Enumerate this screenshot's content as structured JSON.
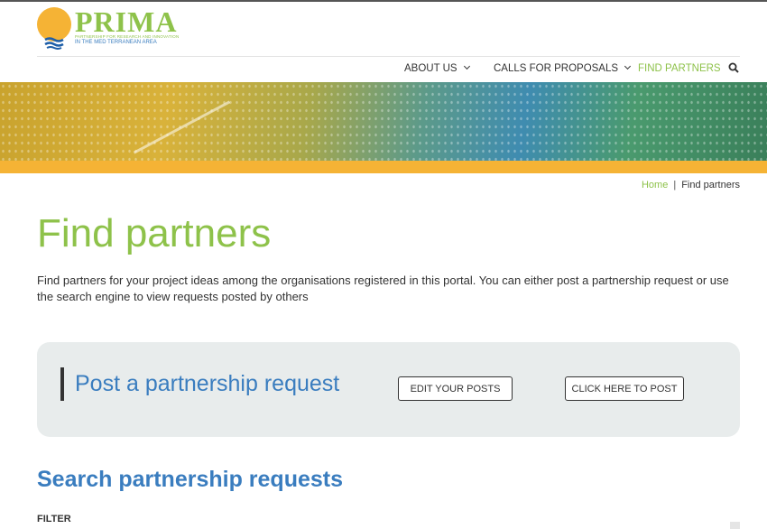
{
  "header": {
    "logo": {
      "word": "PRIMA",
      "subtitle_1": "PARTNERSHIP FOR RESEARCH AND INNOVATION",
      "subtitle_2": "IN THE MED TERRANEAN AREA"
    },
    "nav": {
      "about_us": "ABOUT US",
      "calls_for_proposals": "CALLS FOR PROPOSALS",
      "find_partners": "FIND PARTNERS"
    },
    "search_icon": "search-icon"
  },
  "colors": {
    "accent_green": "#8ec24a",
    "accent_blue": "#3a7dbf",
    "accent_yellow": "#f5b335",
    "panel_bg": "#e8ecec"
  },
  "breadcrumb": {
    "home": "Home",
    "separator": "|",
    "current": "Find partners"
  },
  "main": {
    "title": "Find partners",
    "intro": "Find partners for your project ideas among the organisations registered in this portal. You can either post a partnership request or use the search engine to view requests posted by others",
    "post_panel": {
      "title": "Post a partnership request",
      "edit_button": "EDIT YOUR POSTS",
      "post_button": "CLICK HERE TO POST"
    },
    "search": {
      "title": "Search partnership requests",
      "filter_label": "FILTER"
    }
  }
}
